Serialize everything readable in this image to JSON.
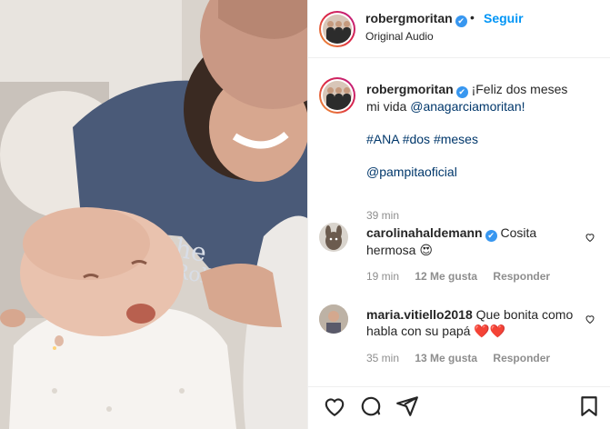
{
  "header": {
    "username": "robergmoritan",
    "verified_mark": "✔",
    "separator": "•",
    "follow_label": "Seguir",
    "audio_label": "Original Audio"
  },
  "caption": {
    "username": "robergmoritan",
    "text_before": "¡Feliz dos meses mi vida ",
    "mention": "@anagarciamoritan!",
    "hashtags": "#ANA #dos #meses",
    "mention2": "@pampitaoficial",
    "time": "39 min"
  },
  "comments": [
    {
      "username": "carolinahaldemann",
      "text": " Cosita hermosa 😍",
      "time": "19 min",
      "likes": "12 Me gusta",
      "reply": "Responder"
    },
    {
      "username": "maria.vitiello2018",
      "text": " Que bonita como habla con su papá ❤️❤️",
      "time": "35 min",
      "likes": "13 Me gusta",
      "reply": "Responder"
    }
  ],
  "icons": [
    "heart-icon",
    "comment-icon",
    "share-icon",
    "bookmark-icon"
  ],
  "colors": {
    "follow": "#0095f6",
    "verified": "#3897f0",
    "meta": "#8e8e8e"
  }
}
